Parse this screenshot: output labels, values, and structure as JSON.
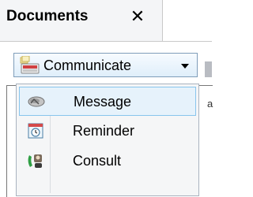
{
  "tab": {
    "title": "Documents",
    "close_glyph": "✕"
  },
  "content": {
    "peek_text": "a"
  },
  "toolbar": {
    "communicate": {
      "label": "Communicate",
      "icon": "communicate-icon"
    }
  },
  "menu": {
    "items": [
      {
        "label": "Message",
        "icon": "message-icon",
        "highlighted": true
      },
      {
        "label": "Reminder",
        "icon": "reminder-icon",
        "highlighted": false
      },
      {
        "label": "Consult",
        "icon": "consult-icon",
        "highlighted": false
      }
    ]
  },
  "colors": {
    "highlight_bg": "#e6f2fb",
    "highlight_border": "#88c5ed",
    "menu_bg": "#f5f6f7"
  }
}
